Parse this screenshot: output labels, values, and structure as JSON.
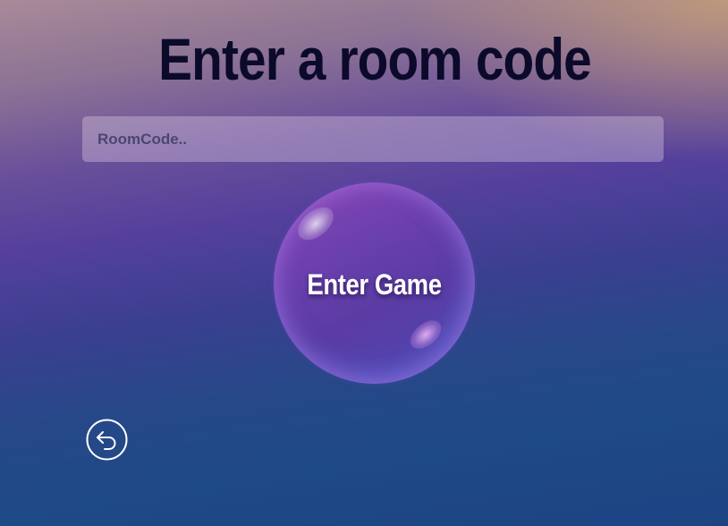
{
  "page": {
    "title": "Enter a room code"
  },
  "room_code": {
    "value": "",
    "placeholder": "RoomCode.."
  },
  "enter_button": {
    "label": "Enter Game"
  },
  "back_button": {
    "icon": "back-arrow-icon"
  },
  "colors": {
    "title_text": "#0c0a2a",
    "bubble_primary": "#6c40ae",
    "background_top": "#a88a98",
    "background_bottom": "#1d4383"
  }
}
